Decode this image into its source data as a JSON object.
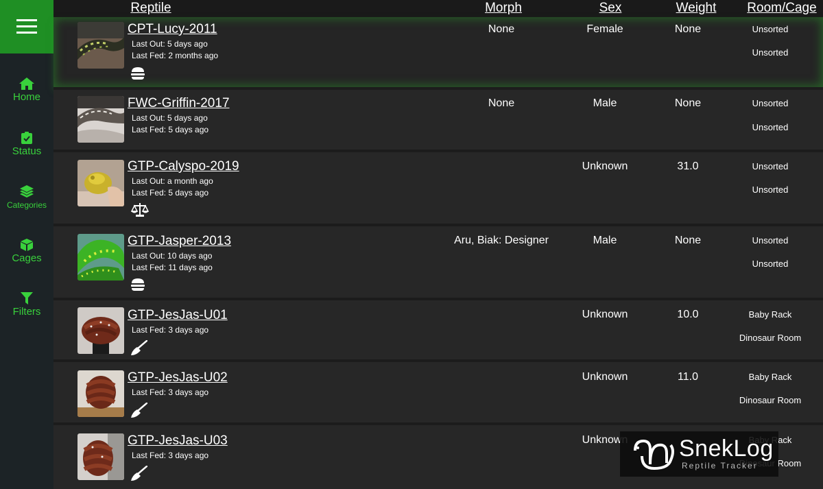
{
  "sidebar": {
    "items": [
      {
        "label": "Home",
        "icon": "home-icon"
      },
      {
        "label": "Status",
        "icon": "clipboard-check-icon"
      },
      {
        "label": "Categories",
        "icon": "layers-icon"
      },
      {
        "label": "Cages",
        "icon": "cube-icon"
      },
      {
        "label": "Filters",
        "icon": "filter-icon"
      }
    ]
  },
  "table": {
    "headers": {
      "reptile": "Reptile",
      "morph": "Morph",
      "sex": "Sex",
      "weight": "Weight",
      "room": "Room/Cage"
    },
    "rows": [
      {
        "name": "CPT-Lucy-2011",
        "last_out": "Last Out: 5 days ago",
        "last_fed": "Last Fed: 2 months ago",
        "status_icon": "burger-icon",
        "morph": "None",
        "sex": "Female",
        "weight": "None",
        "room": "Unsorted",
        "cage": "Unsorted"
      },
      {
        "name": "FWC-Griffin-2017",
        "last_out": "Last Out: 5 days ago",
        "last_fed": "Last Fed: 5 days ago",
        "status_icon": "",
        "morph": "None",
        "sex": "Male",
        "weight": "None",
        "room": "Unsorted",
        "cage": "Unsorted"
      },
      {
        "name": "GTP-Calyspo-2019",
        "last_out": "Last Out: a month ago",
        "last_fed": "Last Fed: 5 days ago",
        "status_icon": "scale-icon",
        "morph": "",
        "sex": "Unknown",
        "weight": "31.0",
        "room": "Unsorted",
        "cage": "Unsorted"
      },
      {
        "name": "GTP-Jasper-2013",
        "last_out": "Last Out: 10 days ago",
        "last_fed": "Last Fed: 11 days ago",
        "status_icon": "burger-icon",
        "morph": "Aru, Biak: Designer",
        "sex": "Male",
        "weight": "None",
        "room": "Unsorted",
        "cage": "Unsorted"
      },
      {
        "name": "GTP-JesJas-U01",
        "last_out": "",
        "last_fed": "Last Fed: 3 days ago",
        "status_icon": "broom-icon",
        "morph": "",
        "sex": "Unknown",
        "weight": "10.0",
        "room": "Baby Rack",
        "cage": "Dinosaur Room"
      },
      {
        "name": "GTP-JesJas-U02",
        "last_out": "",
        "last_fed": "Last Fed: 3 days ago",
        "status_icon": "broom-icon",
        "morph": "",
        "sex": "Unknown",
        "weight": "11.0",
        "room": "Baby Rack",
        "cage": "Dinosaur Room"
      },
      {
        "name": "GTP-JesJas-U03",
        "last_out": "",
        "last_fed": "Last Fed: 3 days ago",
        "status_icon": "broom-icon",
        "morph": "",
        "sex": "Unknown",
        "weight": "",
        "room": "Baby Rack",
        "cage": "Dinosaur Room"
      }
    ]
  },
  "watermark": {
    "title": "SnekLog",
    "subtitle": "Reptile Tracker"
  },
  "colors": {
    "accent": "#1f8f24",
    "nav_text": "#39d13c",
    "background": "#222222",
    "sidebar": "#1c2326"
  }
}
